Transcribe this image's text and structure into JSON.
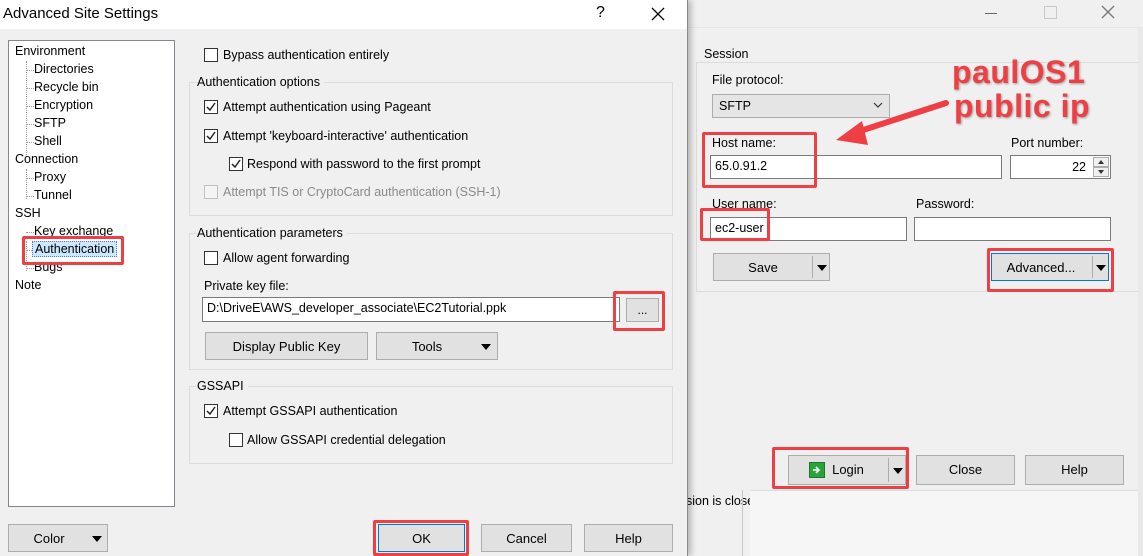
{
  "dialog": {
    "title": "Advanced Site Settings",
    "help_icon": "?",
    "close_icon": "close"
  },
  "tree": {
    "items": [
      {
        "label": "Environment"
      },
      {
        "label": "Directories"
      },
      {
        "label": "Recycle bin"
      },
      {
        "label": "Encryption"
      },
      {
        "label": "SFTP"
      },
      {
        "label": "Shell"
      },
      {
        "label": "Connection"
      },
      {
        "label": "Proxy"
      },
      {
        "label": "Tunnel"
      },
      {
        "label": "SSH"
      },
      {
        "label": "Key exchange"
      },
      {
        "label": "Authentication"
      },
      {
        "label": "Bugs"
      },
      {
        "label": "Note"
      }
    ]
  },
  "auth": {
    "bypass": "Bypass authentication entirely",
    "options_title": "Authentication options",
    "pageant": "Attempt authentication using Pageant",
    "kbd_interactive": "Attempt 'keyboard-interactive' authentication",
    "respond_password": "Respond with password to the first prompt",
    "tis": "Attempt TIS or CryptoCard authentication (SSH-1)",
    "params_title": "Authentication parameters",
    "agent_forwarding": "Allow agent forwarding",
    "private_key_label": "Private key file:",
    "private_key_value": "D:\\DriveE\\AWS_developer_associate\\EC2Tutorial.ppk",
    "browse_label": "...",
    "display_public_key": "Display Public Key",
    "tools": "Tools",
    "gssapi_title": "GSSAPI",
    "gssapi_attempt": "Attempt GSSAPI authentication",
    "gssapi_delegation": "Allow GSSAPI credential delegation"
  },
  "dialog_buttons": {
    "color": "Color",
    "ok": "OK",
    "cancel": "Cancel",
    "help": "Help"
  },
  "session": {
    "group_title": "Session",
    "file_protocol_label": "File protocol:",
    "file_protocol_value": "SFTP",
    "host_label": "Host name:",
    "host_value": "65.0.91.2",
    "port_label": "Port number:",
    "port_value": "22",
    "user_label": "User name:",
    "user_value": "ec2-user",
    "password_label": "Password:",
    "password_value": "",
    "save": "Save",
    "advanced": "Advanced...",
    "login": "Login",
    "close": "Close",
    "help": "Help",
    "status_text": "sion is closed"
  },
  "annotation": {
    "line1": "paulOS1",
    "line2": "public ip",
    "color": "#ee3f45"
  },
  "window_controls": {
    "minimize": "minimize",
    "maximize": "maximize",
    "close": "close"
  }
}
